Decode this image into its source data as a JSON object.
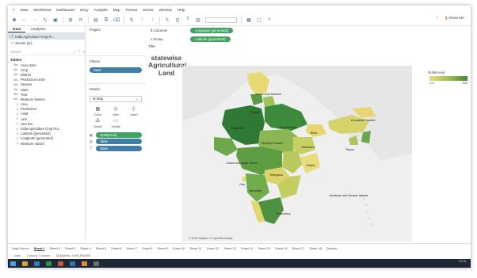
{
  "menubar": [
    "Data",
    "Worksheet",
    "Dashboard",
    "Story",
    "Analysis",
    "Map",
    "Format",
    "Server",
    "Window",
    "Help"
  ],
  "toolbar": {
    "show_me": "Show Me"
  },
  "left_pane": {
    "tabs": [
      "Data",
      "Analytics"
    ],
    "datasources": [
      "India Agriculture Crop Pr...",
      "Sheet1 (ar)"
    ],
    "search_placeholder": "Search",
    "tables_header": "Tables",
    "fields": [
      {
        "type": "Abc",
        "name": "Area Units"
      },
      {
        "type": "Abc",
        "name": "Crop"
      },
      {
        "type": "Abc",
        "name": "District"
      },
      {
        "type": "Abc",
        "name": "Production Units"
      },
      {
        "type": "Abc",
        "name": "Season"
      },
      {
        "type": "Abc",
        "name": "State"
      },
      {
        "type": "Abc",
        "name": "Year"
      },
      {
        "type": "Abc",
        "name": "Measure Names"
      },
      {
        "type": "#",
        "name": "Area"
      },
      {
        "type": "#",
        "name": "Production"
      },
      {
        "type": "#",
        "name": "Yield"
      },
      {
        "type": "#",
        "name": "cars"
      },
      {
        "type": "#",
        "name": "cars line"
      },
      {
        "type": "#",
        "name": "India Agriculture Crop Pro..."
      },
      {
        "type": "#",
        "name": "Latitude (generated)"
      },
      {
        "type": "#",
        "name": "Longitude (generated)"
      },
      {
        "type": "#",
        "name": "Measure Values"
      }
    ]
  },
  "pages_label": "Pages",
  "filters": {
    "label": "Filters",
    "pill": "State"
  },
  "marks": {
    "label": "Marks",
    "type": "Map",
    "buttons": [
      "Color",
      "Size",
      "Label",
      "Detail",
      "Tooltip"
    ],
    "pills": [
      {
        "label": "SUM(Area)",
        "color": "green"
      },
      {
        "label": "State",
        "color": "blue"
      },
      {
        "label": "State",
        "color": "blue"
      }
    ]
  },
  "shelves": {
    "columns_label": "Columns",
    "rows_label": "Rows",
    "columns_pill": "Longitude (generated)",
    "rows_pill": "Latitude (generated)"
  },
  "title_label": "Title",
  "view_title": "statewise Agricultural Land",
  "map": {
    "attribution": "© 2023 Mapbox © OpenStreetMap",
    "labels": {
      "jammu": "Jammu and Kashmir",
      "punjab": "Punjab",
      "rajasthan": "Rajasthan",
      "uttar": "Uttar Pradesh",
      "madhya": "Madhya Pradesh",
      "bihar": "Bihar",
      "arunachal": "Arunachal Pradesh",
      "jharkhand": "Jharkhand",
      "tripura": "Tripura",
      "odisha": "Odisha",
      "dadra": "Dadra and Nagar Haveli",
      "telangana": "Telangana",
      "goa": "Goa",
      "karnataka": "Karnataka",
      "puducherry": "Puducherry",
      "andaman": "Andaman and Nicobar Islands"
    }
  },
  "legend": {
    "title": "SUM(Area)",
    "min": "273",
    "max": "643"
  },
  "sheet_tabs": [
    "Data Source",
    "Sheet 1",
    "Sheet 2",
    "Sheet 3",
    "Sheet 4",
    "Sheet 5",
    "Sheet 6",
    "Sheet 7",
    "Sheet 8",
    "Sheet 9",
    "Sheet 10",
    "Sheet 11",
    "Sheet 12",
    "Sheet 13",
    "Sheet 14",
    "Sheet 15",
    "Sheet 16",
    "Sheet 17",
    "Sheet 18",
    "Dashbo"
  ],
  "status": [
    "rows",
    "1 row by 1 column",
    "SUM(Area): 4,530,980,608"
  ],
  "taskbar_time": "23:16",
  "colors": {
    "accent_green": "#3fa25e",
    "accent_blue": "#3f7fa6",
    "map_light": "#e3d56e",
    "map_dark": "#3a8a3a",
    "taskbar": "#1e2735"
  }
}
